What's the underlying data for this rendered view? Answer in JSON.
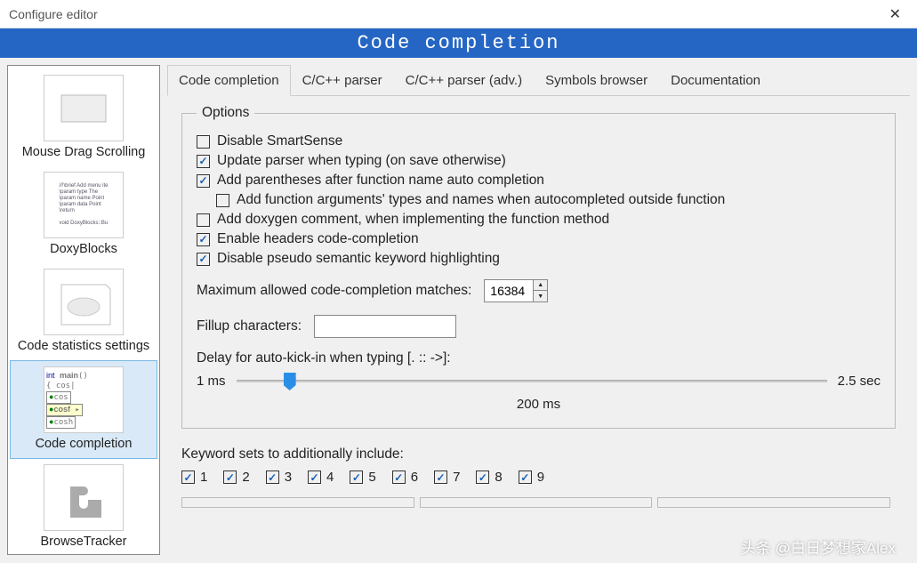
{
  "window": {
    "title": "Configure editor"
  },
  "header": "Code completion",
  "sidebar": {
    "items": [
      {
        "label": "Mouse Drag Scrolling"
      },
      {
        "label": "DoxyBlocks"
      },
      {
        "label": "Code statistics settings"
      },
      {
        "label": "Code completion",
        "selected": true
      },
      {
        "label": "BrowseTracker"
      }
    ]
  },
  "tabs": [
    {
      "label": "Code completion",
      "active": true
    },
    {
      "label": "C/C++ parser"
    },
    {
      "label": "C/C++ parser (adv.)"
    },
    {
      "label": "Symbols browser"
    },
    {
      "label": "Documentation"
    }
  ],
  "options": {
    "legend": "Options",
    "checks": [
      {
        "label": "Disable SmartSense",
        "checked": false
      },
      {
        "label": "Update parser when typing (on save otherwise)",
        "checked": true
      },
      {
        "label": "Add parentheses after function name auto completion",
        "checked": true
      },
      {
        "label": "Add function arguments' types and names when autocompleted outside function",
        "checked": false,
        "indent": true
      },
      {
        "label": "Add doxygen comment, when implementing the function method",
        "checked": false
      },
      {
        "label": "Enable headers code-completion",
        "checked": true
      },
      {
        "label": "Disable pseudo semantic keyword highlighting",
        "checked": true
      }
    ],
    "max_matches": {
      "label": "Maximum allowed code-completion matches:",
      "value": "16384"
    },
    "fillup": {
      "label": "Fillup characters:",
      "value": ""
    },
    "delay": {
      "label": "Delay for auto-kick-in when typing [. :: ->]:",
      "min": "1 ms",
      "max": "2.5 sec",
      "value": "200 ms"
    }
  },
  "keyword_sets": {
    "label": "Keyword sets to additionally include:",
    "items": [
      "1",
      "2",
      "3",
      "4",
      "5",
      "6",
      "7",
      "8",
      "9"
    ]
  },
  "watermark": "头条 @白日梦想家Alex"
}
